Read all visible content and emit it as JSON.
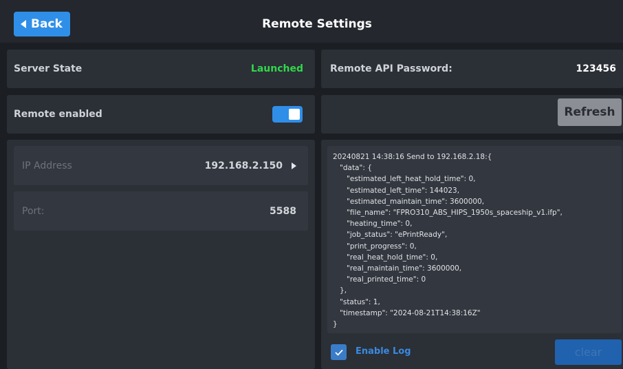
{
  "header": {
    "back_label": "Back",
    "title": "Remote Settings"
  },
  "server": {
    "state_label": "Server State",
    "state_value": "Launched",
    "state_color": "#32d74b"
  },
  "remote": {
    "enabled_label": "Remote enabled",
    "enabled": true
  },
  "network": {
    "ip_label": "IP Address",
    "ip_value": "192.168.2.150",
    "port_label": "Port:",
    "port_value": "5588"
  },
  "api": {
    "password_label": "Remote API Password:",
    "password_value": "123456",
    "refresh_label": "Refresh"
  },
  "log": {
    "text": "20240821 14:38:16 Send to 192.168.2.18:{\n   \"data\": {\n      \"estimated_left_heat_hold_time\": 0,\n      \"estimated_left_time\": 144023,\n      \"estimated_maintain_time\": 3600000,\n      \"file_name\": \"FPRO310_ABS_HIPS_1950s_spaceship_v1.ifp\",\n      \"heating_time\": 0,\n      \"job_status\": \"ePrintReady\",\n      \"print_progress\": 0,\n      \"real_heat_hold_time\": 0,\n      \"real_maintain_time\": 3600000,\n      \"real_printed_time\": 0\n   },\n   \"status\": 1,\n   \"timestamp\": \"2024-08-21T14:38:16Z\"\n}",
    "enable_label": "Enable Log",
    "enable_checked": true,
    "clear_label": "clear"
  },
  "colors": {
    "accent": "#2f8fe8",
    "background": "#1b1e23",
    "panel": "#2b2f36"
  }
}
